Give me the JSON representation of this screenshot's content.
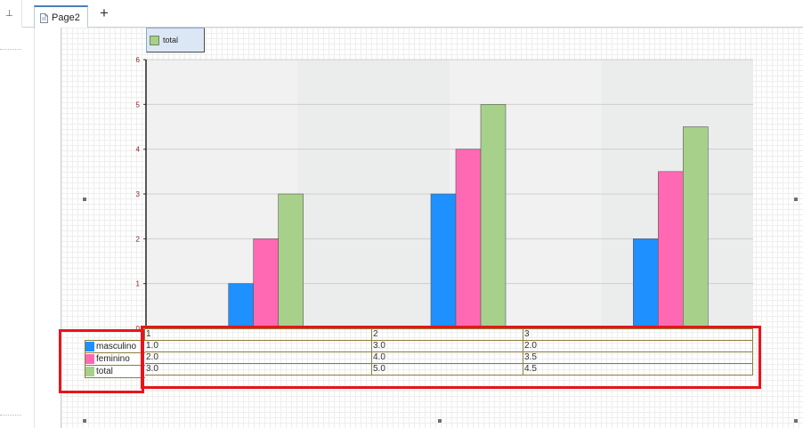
{
  "tabs": [
    {
      "label": "Page2",
      "active": true
    }
  ],
  "add_tab_glyph": "+",
  "pin_glyph": "⊥",
  "colors": {
    "masculino": "#1e90ff",
    "feminino": "#ff69b4",
    "total": "#a7d08a",
    "tick": "#8b1a1a",
    "highlight": "#e8141a"
  },
  "legend": {
    "label": "total"
  },
  "chart_data": {
    "type": "bar",
    "categories": [
      "1",
      "2",
      "3"
    ],
    "series": [
      {
        "name": "masculino",
        "values": [
          1,
          3,
          2
        ]
      },
      {
        "name": "feminino",
        "values": [
          2,
          4,
          3.5
        ]
      },
      {
        "name": "total",
        "values": [
          3,
          5,
          4.5
        ]
      }
    ],
    "ylim": [
      0,
      6
    ],
    "yticks": [
      "0",
      "1",
      "2",
      "3",
      "4",
      "5",
      "6"
    ],
    "grid": true,
    "legend": "top-left"
  },
  "table": {
    "header": [
      "1",
      "2",
      "3"
    ],
    "rows": [
      {
        "label": "masculino",
        "cells": [
          "1.0",
          "3.0",
          "2.0"
        ]
      },
      {
        "label": "feminino",
        "cells": [
          "2.0",
          "4.0",
          "3.5"
        ]
      },
      {
        "label": "total",
        "cells": [
          "3.0",
          "5.0",
          "4.5"
        ]
      }
    ]
  }
}
